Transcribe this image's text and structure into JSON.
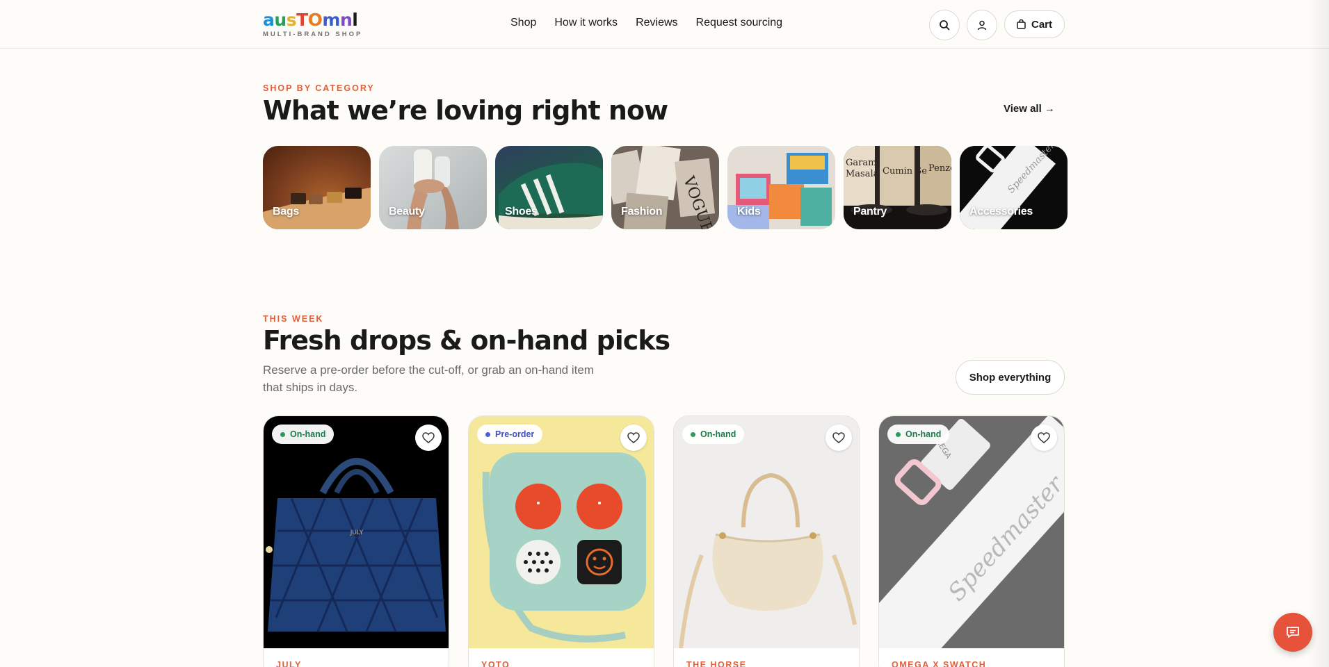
{
  "header": {
    "logo_letters": [
      "a",
      "u",
      "s",
      "T",
      "O",
      "m",
      "n",
      "l"
    ],
    "logo_tagline": "MULTI-BRAND SHOP",
    "nav": [
      "Shop",
      "How it works",
      "Reviews",
      "Request sourcing"
    ],
    "cart_label": "Cart"
  },
  "categories_section": {
    "eyebrow": "SHOP BY CATEGORY",
    "title": "What we’re loving right now",
    "view_all": "View all →",
    "items": [
      {
        "label": "Bags",
        "color": "#7a3d1e"
      },
      {
        "label": "Beauty",
        "color": "#bfc4c6"
      },
      {
        "label": "Shoes",
        "color": "#1f5a48"
      },
      {
        "label": "Fashion",
        "color": "#5b4d46"
      },
      {
        "label": "Kids",
        "color": "#d4c8bf"
      },
      {
        "label": "Pantry",
        "color": "#3a2f2a"
      },
      {
        "label": "Accessories",
        "color": "#0c0c0c"
      }
    ]
  },
  "products_section": {
    "eyebrow": "THIS WEEK",
    "title": "Fresh drops & on-hand picks",
    "subtitle": "Reserve a pre-order before the cut-off, or grab an on-hand item that ships in days.",
    "cta": "Shop everything",
    "items": [
      {
        "badge": "On-hand",
        "brand": "JULY",
        "bg": "#000000",
        "wm": "JULY"
      },
      {
        "badge": "Pre-order",
        "brand": "YOTO",
        "bg": "#f5e89a",
        "wm": ""
      },
      {
        "badge": "On-hand",
        "brand": "THE HORSE",
        "bg": "#efeeec",
        "wm": ""
      },
      {
        "badge": "On-hand",
        "brand": "OMEGA X SWATCH",
        "bg": "#6b6b6b",
        "wm": "Speedmaster"
      }
    ]
  },
  "icons": {
    "search": "search-icon",
    "account": "user-icon",
    "cart": "shopping-bag-icon",
    "wishlist": "heart-icon",
    "chat": "chat-icon"
  }
}
